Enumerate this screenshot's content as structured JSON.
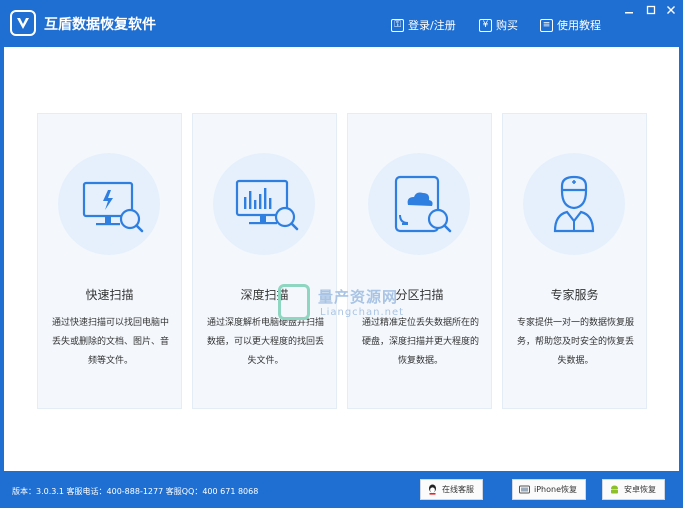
{
  "app": {
    "title": "互盾数据恢复软件"
  },
  "titlebar": {
    "login": "登录/注册",
    "buy": "购买",
    "tutorial": "使用教程"
  },
  "cards": [
    {
      "title": "快速扫描",
      "desc": "通过快速扫描可以找回电脑中丢失或删除的文档、图片、音频等文件。"
    },
    {
      "title": "深度扫描",
      "desc": "通过深度解析电脑硬盘并扫描数据，可以更大程度的找回丢失文件。"
    },
    {
      "title": "分区扫描",
      "desc": "通过精准定位丢失数据所在的硬盘，深度扫描并更大程度的恢复数据。"
    },
    {
      "title": "专家服务",
      "desc": "专家提供一对一的数据恢复服务，帮助您及时安全的恢复丢失数据。"
    }
  ],
  "watermark": {
    "title": "量产资源网",
    "subtitle": "Liangchan.net"
  },
  "statusbar": {
    "info": "版本：3.0.3.1  客服电话：400-888-1277   客服QQ：400 671 8068",
    "online_service": "在线客服",
    "iphone_recovery": "iPhone恢复",
    "android_recovery": "安卓恢复"
  },
  "colors": {
    "brand": "#1f6fd2",
    "icon": "#2f7fe0",
    "circle": "#e6f0fc"
  }
}
